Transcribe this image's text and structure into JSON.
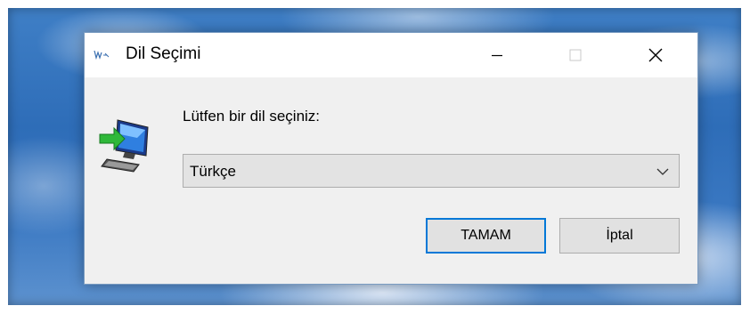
{
  "window": {
    "title": "Dil Seçimi"
  },
  "controls": {
    "minimize_icon": "minimize-icon",
    "maximize_icon": "maximize-icon",
    "close_icon": "close-icon"
  },
  "content": {
    "prompt": "Lütfen bir dil seçiniz:",
    "language_select": {
      "selected": "Türkçe"
    }
  },
  "buttons": {
    "ok_label": "TAMAM",
    "cancel_label": "İptal"
  },
  "colors": {
    "accent": "#0078d7",
    "dialog_bg": "#f0f0f0",
    "title_bg": "#ffffff"
  }
}
